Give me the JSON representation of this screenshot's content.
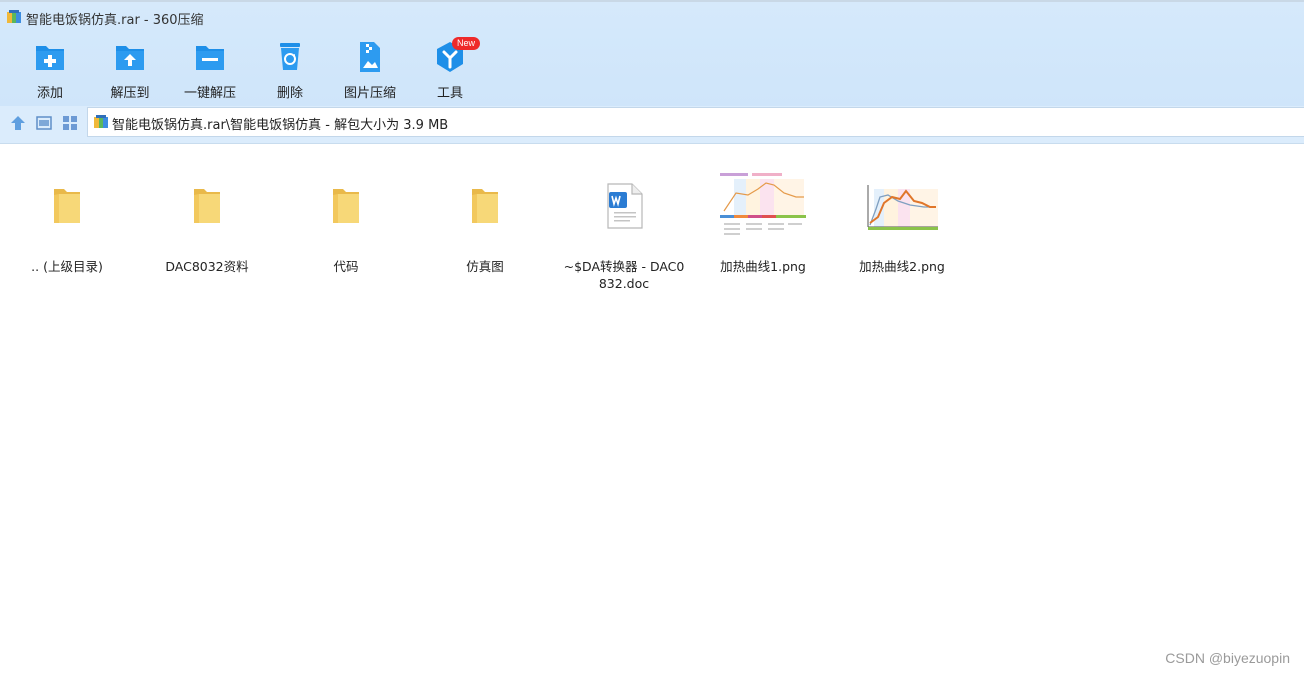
{
  "window": {
    "title": "智能电饭锅仿真.rar - 360压缩"
  },
  "toolbar": {
    "items": [
      {
        "label": "添加",
        "icon": "add-folder-icon"
      },
      {
        "label": "解压到",
        "icon": "extract-to-icon"
      },
      {
        "label": "一键解压",
        "icon": "one-click-extract-icon"
      },
      {
        "label": "删除",
        "icon": "recycle-bin-icon"
      },
      {
        "label": "图片压缩",
        "icon": "image-compress-icon"
      },
      {
        "label": "工具",
        "icon": "tools-icon",
        "badge": "New"
      }
    ]
  },
  "navbar": {
    "path": "智能电饭锅仿真.rar\\智能电饭锅仿真 - 解包大小为 3.9 MB"
  },
  "files": [
    {
      "name": ".. (上级目录)",
      "type": "folder"
    },
    {
      "name": "DAC8032资料",
      "type": "folder"
    },
    {
      "name": "代码",
      "type": "folder"
    },
    {
      "name": "仿真图",
      "type": "folder"
    },
    {
      "name": "~$DA转换器 - DAC0832.doc",
      "type": "word"
    },
    {
      "name": "加热曲线1.png",
      "type": "image"
    },
    {
      "name": "加热曲线2.png",
      "type": "image"
    }
  ],
  "watermark": "CSDN @biyezuopin",
  "colors": {
    "toolbar_bg": "#d3e8fb",
    "icon_blue": "#1e8fe8",
    "folder_yellow": "#f5cd62",
    "badge_red": "#ee2a2a"
  }
}
